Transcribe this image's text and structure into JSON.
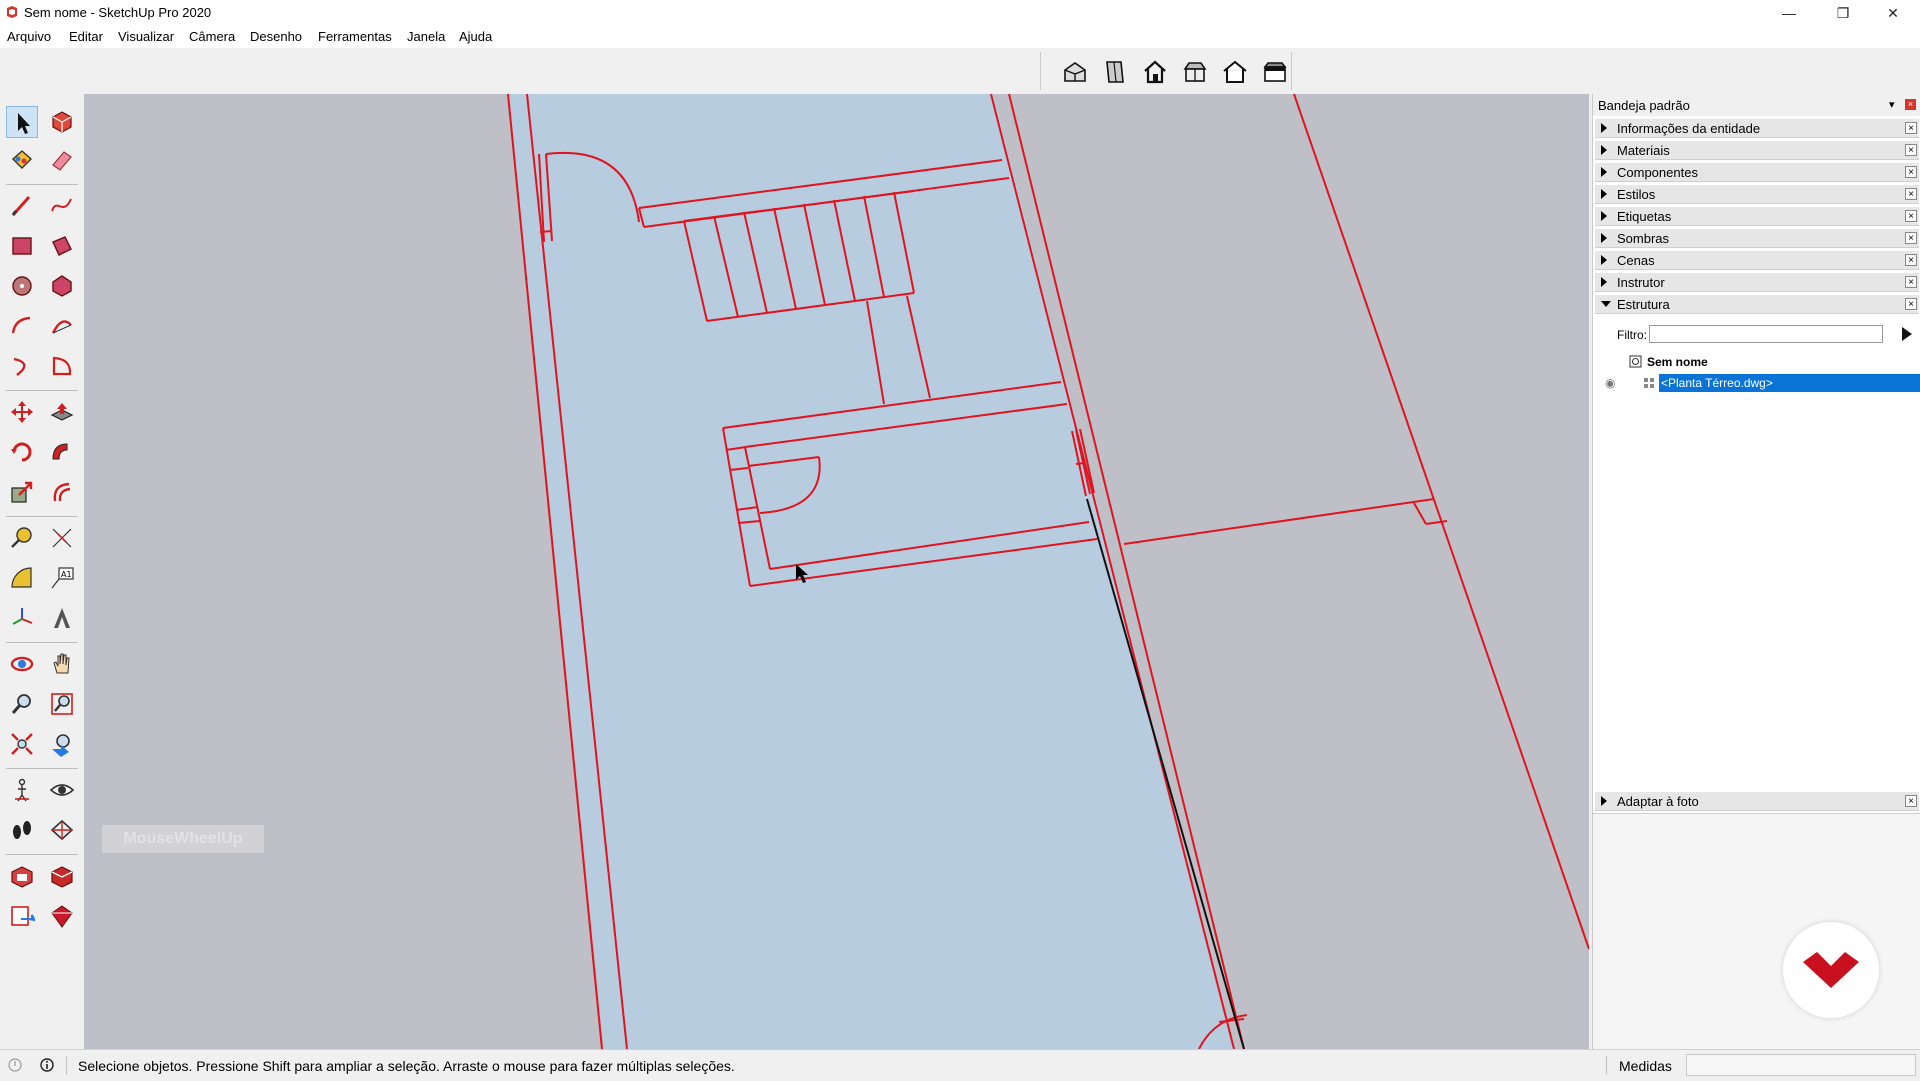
{
  "window": {
    "title": "Sem nome - SketchUp Pro 2020",
    "minimize_glyph": "—",
    "restore_glyph": "❐",
    "close_glyph": "✕"
  },
  "menu": {
    "items": [
      "Arquivo",
      "Editar",
      "Visualizar",
      "Câmera",
      "Desenho",
      "Ferramentas",
      "Janela",
      "Ajuda"
    ]
  },
  "views_toolbar": {
    "buttons": [
      "iso-view-icon",
      "top-view-icon",
      "front-view-icon",
      "right-view-icon",
      "back-view-icon",
      "left-view-icon"
    ]
  },
  "left_toolbar": {
    "tools": [
      "select-icon",
      "make-component-icon",
      "paint-bucket-icon",
      "eraser-icon",
      "line-icon",
      "freehand-icon",
      "rectangle-icon",
      "rotated-rectangle-icon",
      "circle-icon",
      "polygon-icon",
      "arc-icon",
      "two-point-arc-icon",
      "three-point-arc-icon",
      "pie-icon",
      "move-icon",
      "push-pull-icon",
      "rotate-icon",
      "follow-me-icon",
      "scale-icon",
      "offset-icon",
      "tape-measure-icon",
      "dimension-icon",
      "protractor-icon",
      "text-icon",
      "axes-icon",
      "3d-text-icon",
      "orbit-icon",
      "pan-icon",
      "zoom-icon",
      "zoom-window-icon",
      "zoom-extents-icon",
      "previous-view-icon",
      "position-camera-icon",
      "look-around-icon",
      "walk-icon",
      "section-plane-icon",
      "3d-warehouse-icon",
      "extension-warehouse-icon",
      "layout-icon",
      "extension-manager-icon"
    ]
  },
  "viewport": {
    "overlay_label": "MouseWheelUp",
    "colors": {
      "floor": "#b8cce0",
      "edge": "#e0141e",
      "background": "#bfbfc7"
    }
  },
  "tray": {
    "title": "Bandeja padrão",
    "pin_glyph": "📌",
    "close_glyph": "×",
    "panels": [
      {
        "label": "Informações da entidade",
        "expanded": false
      },
      {
        "label": "Materiais",
        "expanded": false
      },
      {
        "label": "Componentes",
        "expanded": false
      },
      {
        "label": "Estilos",
        "expanded": false
      },
      {
        "label": "Etiquetas",
        "expanded": false
      },
      {
        "label": "Sombras",
        "expanded": false
      },
      {
        "label": "Cenas",
        "expanded": false
      },
      {
        "label": "Instrutor",
        "expanded": false
      },
      {
        "label": "Estrutura",
        "expanded": true
      }
    ],
    "filter": {
      "label": "Filtro:",
      "value": "",
      "placeholder": ""
    },
    "outliner": {
      "root": "Sem nome",
      "child": "<Planta Térreo.dwg>"
    },
    "bottom_panel": {
      "label": "Adaptar à foto",
      "expanded": false
    },
    "panel_close_glyph": "×"
  },
  "status": {
    "message": "Selecione objetos. Pressione Shift para ampliar a seleção. Arraste o mouse para fazer múltiplas seleções.",
    "measures_label": "Medidas",
    "measures_value": ""
  }
}
